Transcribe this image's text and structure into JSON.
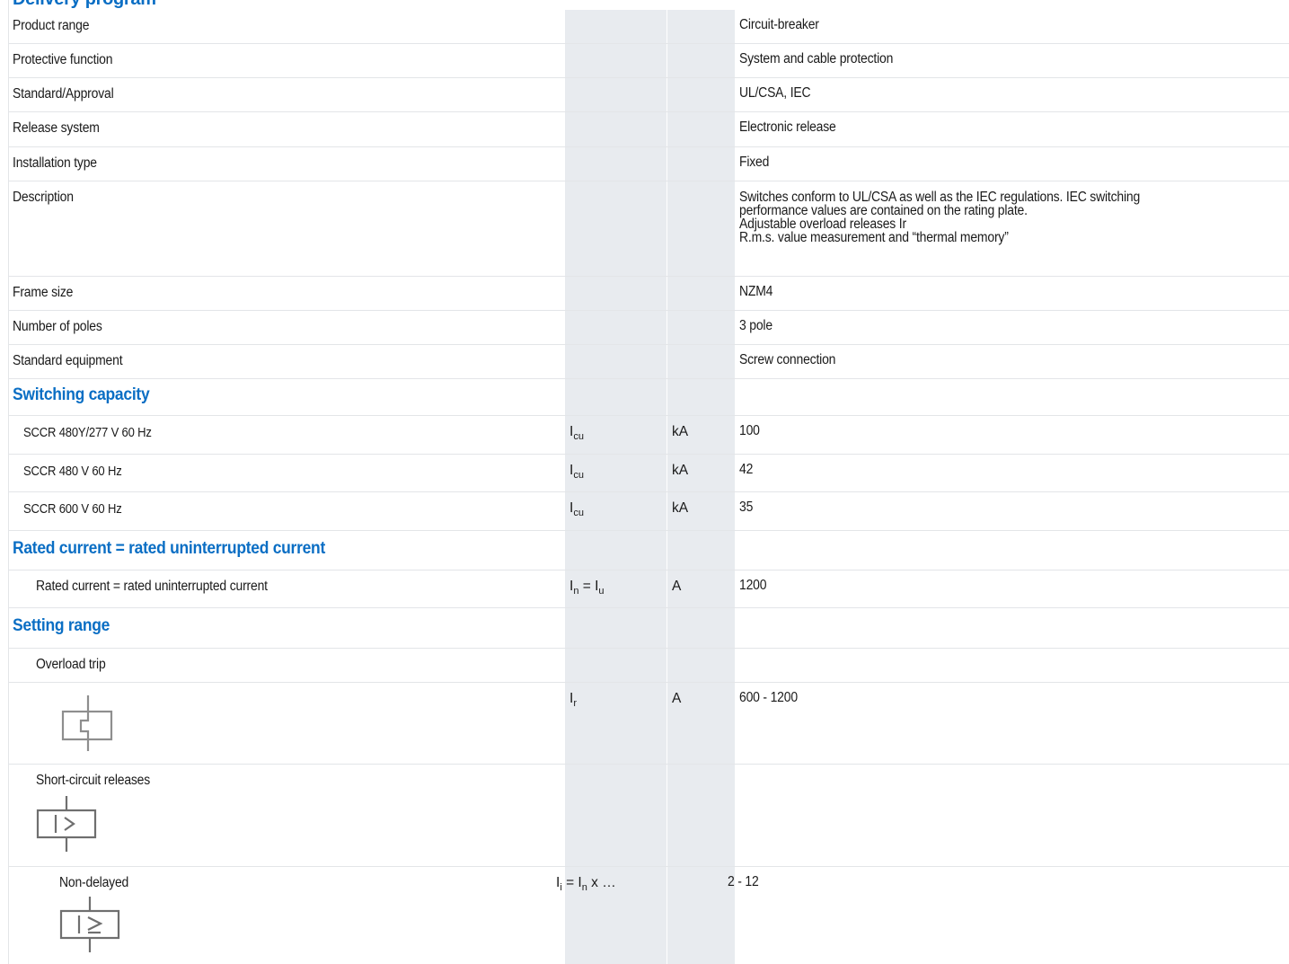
{
  "page": {
    "top_heading": "Delivery program"
  },
  "general": [
    {
      "label": "Product range",
      "value": "Circuit-breaker"
    },
    {
      "label": "Protective function",
      "value": "System and cable protection"
    },
    {
      "label": "Standard/Approval",
      "value": "UL/CSA, IEC"
    },
    {
      "label": "Release system",
      "value": "Electronic release"
    },
    {
      "label": "Installation type",
      "value": "Fixed"
    },
    {
      "label": "Description",
      "value_lines": [
        "Switches conform to UL/CSA as well as the IEC regulations. IEC switching",
        "performance values are contained on the rating plate.",
        "Adjustable overload releases Ir",
        "R.m.s. value measurement and “thermal memory”"
      ]
    },
    {
      "label": "Frame size",
      "value": "NZM4"
    },
    {
      "label": "Number of poles",
      "value": "3 pole"
    },
    {
      "label": "Standard equipment",
      "value": "Screw connection"
    }
  ],
  "switching_capacity": {
    "title": "Switching capacity",
    "rows": [
      {
        "label": "SCCR 480Y/277 V 60 Hz",
        "sym": "I",
        "sym_sub": "cu",
        "unit": "kA",
        "value": "100"
      },
      {
        "label": "SCCR 480 V 60 Hz",
        "sym": "I",
        "sym_sub": "cu",
        "unit": "kA",
        "value": "42"
      },
      {
        "label": "SCCR 600 V 60 Hz",
        "sym": "I",
        "sym_sub": "cu",
        "unit": "kA",
        "value": "35"
      }
    ]
  },
  "rated_current": {
    "title": "Rated current = rated uninterrupted current",
    "row": {
      "label": "Rated current = rated uninterrupted current",
      "sym_a": "I",
      "sym_a_sub": "n",
      "sym_eq": " = ",
      "sym_b": "I",
      "sym_b_sub": "u",
      "unit": "A",
      "value": "1200"
    }
  },
  "setting_range": {
    "title": "Setting range",
    "overload_trip": {
      "label": "Overload trip",
      "icon": "overload-release-symbol-icon"
    },
    "overload_value": {
      "sym": "I",
      "sym_sub": "r",
      "unit": "A",
      "value": "600 - 1200"
    },
    "short_circuit": {
      "label": "Short-circuit releases",
      "icon": "short-circuit-release-symbol-icon"
    },
    "non_delayed": {
      "label": "Non-delayed",
      "sym_a": "I",
      "sym_a_sub": "i",
      "sym_mid": " = I",
      "sym_b_sub": "n",
      "sym_tail": " x …",
      "value": "2 - 12",
      "icon": "instantaneous-release-symbol-icon"
    }
  },
  "colors": {
    "accent": "#0a6ec4",
    "column_shade": "#e8ebef",
    "rule": "#e3e5e8"
  }
}
